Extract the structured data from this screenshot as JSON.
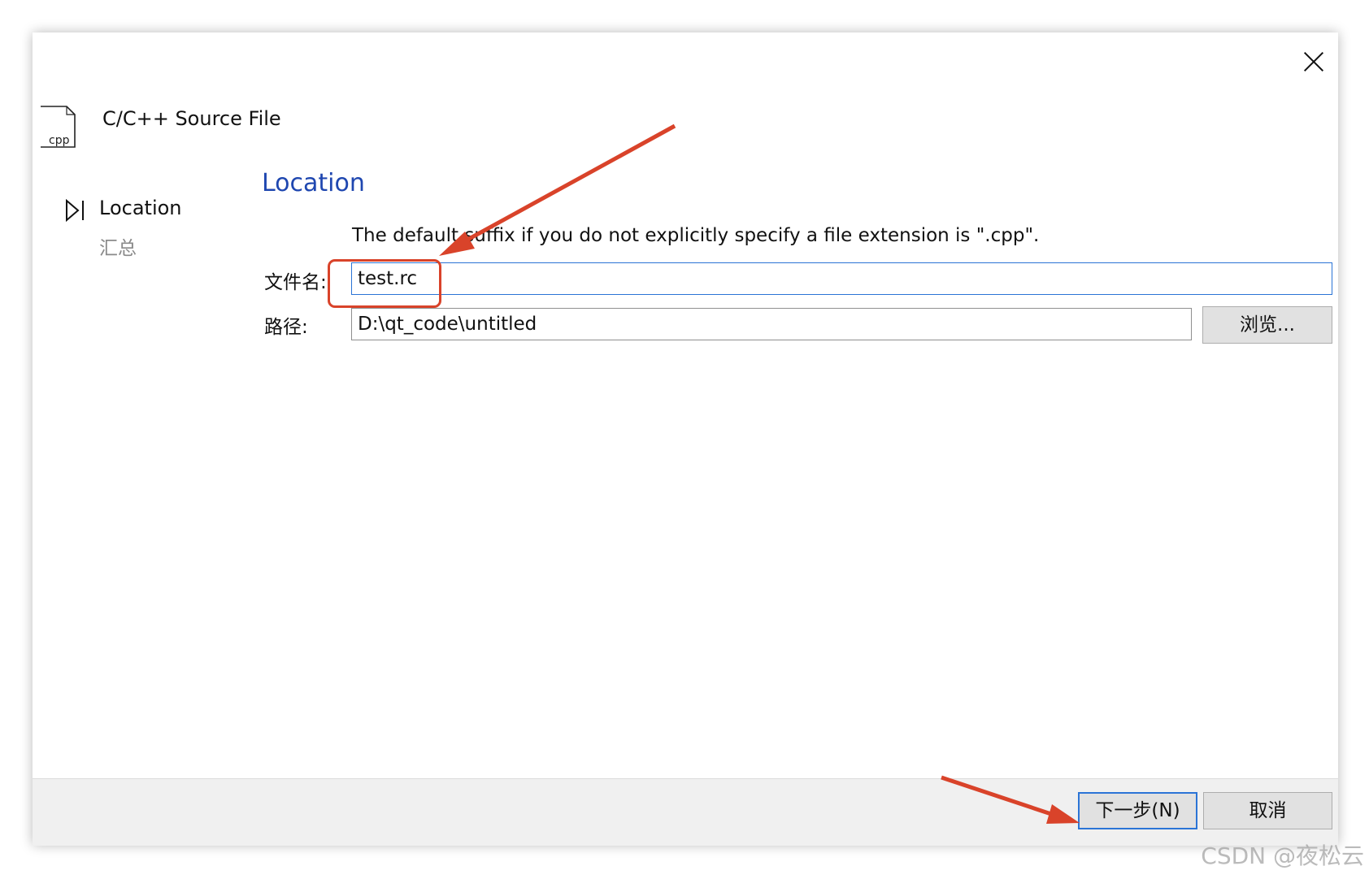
{
  "window": {
    "title": "C/C++ Source File",
    "file_icon_label": "cpp"
  },
  "wizard_nav": {
    "current_step": "Location",
    "next_step": "汇总"
  },
  "page": {
    "title": "Location",
    "hint": "The default suffix if you do not explicitly specify a file extension is \".cpp\".",
    "filename_label": "文件名:",
    "filename_value": "test.rc",
    "path_label": "路径:",
    "path_value": "D:\\qt_code\\untitled",
    "browse_label": "浏览..."
  },
  "footer": {
    "next_label": "下一步(N)",
    "cancel_label": "取消"
  },
  "watermark": "CSDN @夜松云",
  "colors": {
    "accent": "#1f47b0",
    "focus": "#2b74d6",
    "annotation": "#d9432a"
  }
}
